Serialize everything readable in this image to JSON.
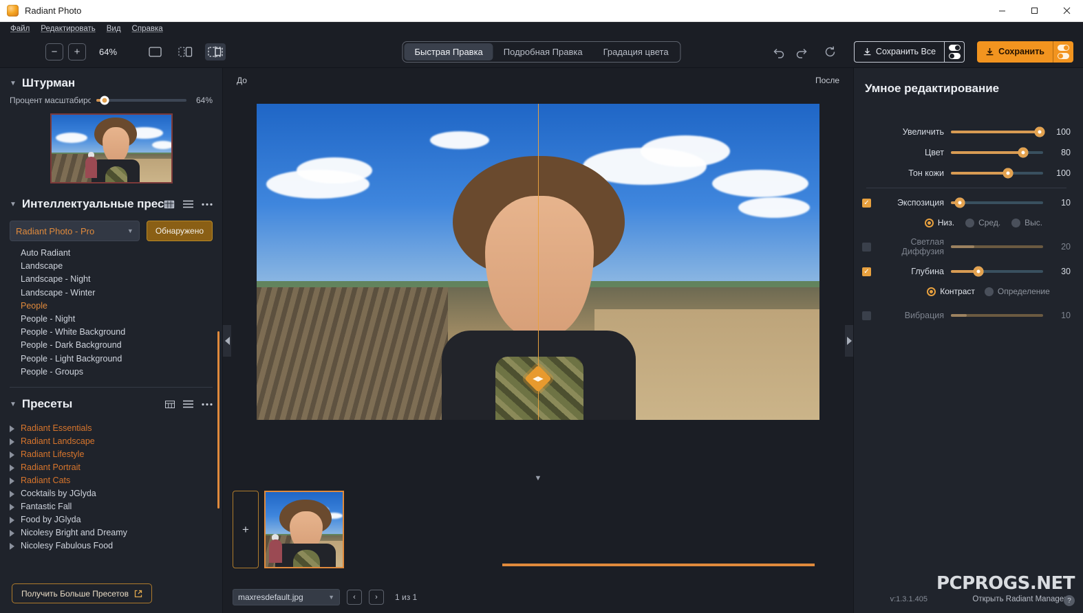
{
  "window": {
    "title": "Radiant Photo",
    "app_icon": "radiant-photo-logo",
    "minimize": "—",
    "maximize": "☐",
    "close": "✕"
  },
  "menubar": {
    "items": [
      "Файл",
      "Редактировать",
      "Вид",
      "Справка"
    ]
  },
  "toolbar": {
    "zoom_out": "−",
    "zoom_in": "+",
    "zoom_value": "64%",
    "view_modes": [
      {
        "name": "single-view",
        "active": false
      },
      {
        "name": "side-by-side-view",
        "active": false
      },
      {
        "name": "split-overlay-view",
        "active": true
      }
    ],
    "tabs": [
      {
        "label": "Быстрая Правка",
        "active": true
      },
      {
        "label": "Подробная Правка",
        "active": false
      },
      {
        "label": "Градация цвета",
        "active": false
      }
    ],
    "undo": "undo-icon",
    "redo": "redo-icon",
    "reset": "reset-icon",
    "save_all_label": "Сохранить Все",
    "save_label": "Сохранить"
  },
  "left_panel": {
    "navigator": {
      "title": "Штурман",
      "zoom_label": "Процент масштабирования",
      "zoom_value": "64%",
      "zoom_percent": 64
    },
    "smart_presets": {
      "title": "Интеллектуальные пресеты",
      "profile": "Radiant Photo - Pro",
      "detected_button": "Обнаружено",
      "items": [
        {
          "label": "Auto Radiant",
          "selected": false
        },
        {
          "label": "Landscape",
          "selected": false
        },
        {
          "label": "Landscape - Night",
          "selected": false
        },
        {
          "label": "Landscape - Winter",
          "selected": false
        },
        {
          "label": "People",
          "selected": true
        },
        {
          "label": "People - Night",
          "selected": false
        },
        {
          "label": "People - White Background",
          "selected": false
        },
        {
          "label": "People - Dark Background",
          "selected": false
        },
        {
          "label": "People - Light Background",
          "selected": false
        },
        {
          "label": "People - Groups",
          "selected": false
        }
      ]
    },
    "presets": {
      "title": "Пресеты",
      "items": [
        {
          "label": "Radiant Essentials",
          "accent": true
        },
        {
          "label": "Radiant Landscape",
          "accent": true
        },
        {
          "label": "Radiant Lifestyle",
          "accent": true
        },
        {
          "label": "Radiant Portrait",
          "accent": true
        },
        {
          "label": "Radiant Cats",
          "accent": true
        },
        {
          "label": "Cocktails by JGlyda",
          "accent": false
        },
        {
          "label": "Fantastic Fall",
          "accent": false
        },
        {
          "label": "Food by JGlyda",
          "accent": false
        },
        {
          "label": "Nicolesy Bright and Dreamy",
          "accent": false
        },
        {
          "label": "Nicolesy Fabulous Food",
          "accent": false
        }
      ],
      "more_button": "Получить Больше Пресетов"
    }
  },
  "canvas": {
    "before_label": "До",
    "after_label": "После",
    "split_handle": "split-compare-handle"
  },
  "filmstrip": {
    "add_label": "+",
    "thumbnail_name": "maxresdefault.jpg"
  },
  "statusbar": {
    "file_name": "maxresdefault.jpg",
    "prev": "‹",
    "next": "›",
    "page_count": "1 из 1"
  },
  "right_panel": {
    "title": "Умное редактирование",
    "sliders": [
      {
        "checkbox": "none",
        "label": "Увеличить",
        "value": "100",
        "percent": 96,
        "knob": true,
        "enabled": true
      },
      {
        "checkbox": "none",
        "label": "Цвет",
        "value": "80",
        "percent": 78,
        "knob": true,
        "enabled": true
      },
      {
        "checkbox": "none",
        "label": "Тон кожи",
        "value": "100",
        "percent": 62,
        "knob": true,
        "enabled": true
      },
      {
        "checkbox": "on",
        "label": "Экспозиция",
        "value": "10",
        "percent": 10,
        "knob": true,
        "enabled": true
      },
      {
        "checkbox": "off",
        "label": "Светлая Диффузия",
        "value": "20",
        "percent": 25,
        "knob": false,
        "enabled": false
      },
      {
        "checkbox": "on",
        "label": "Глубина",
        "value": "30",
        "percent": 30,
        "knob": true,
        "enabled": true
      },
      {
        "checkbox": "off",
        "label": "Вибрация",
        "value": "10",
        "percent": 17,
        "knob": false,
        "enabled": false
      }
    ],
    "exposure_radios": [
      {
        "label": "Низ.",
        "selected": true
      },
      {
        "label": "Сред.",
        "selected": false
      },
      {
        "label": "Выс.",
        "selected": false
      }
    ],
    "depth_radios": [
      {
        "label": "Контраст",
        "selected": true
      },
      {
        "label": "Определение",
        "selected": false
      }
    ],
    "version": "v:1.3.1.405",
    "manager_link": "Открыть Radiant Manager",
    "watermark": "PCPROGS.NET"
  },
  "colors": {
    "accent": "#e08a3c",
    "accent_button": "#f2941f",
    "panel_bg": "#20242c",
    "left_panel_bg": "#1f232b",
    "canvas_bg": "#1b1e25"
  }
}
